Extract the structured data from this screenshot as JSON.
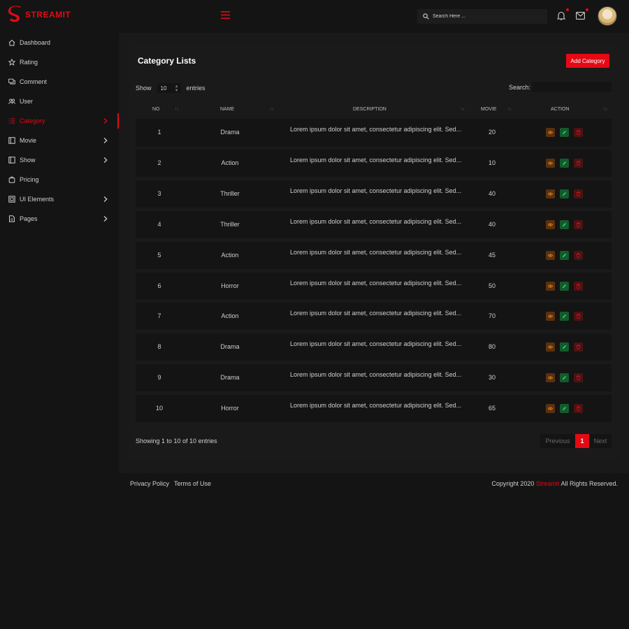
{
  "brand": {
    "name": "STREAMIT",
    "accent": "#e50914"
  },
  "sidebar": {
    "items": [
      {
        "label": "Dashboard",
        "icon": "home-icon",
        "has_submenu": false
      },
      {
        "label": "Rating",
        "icon": "star-icon",
        "has_submenu": false
      },
      {
        "label": "Comment",
        "icon": "comment-icon",
        "has_submenu": false
      },
      {
        "label": "User",
        "icon": "users-icon",
        "has_submenu": false
      },
      {
        "label": "Category",
        "icon": "list-icon",
        "has_submenu": true,
        "active": true
      },
      {
        "label": "Movie",
        "icon": "film-icon",
        "has_submenu": true
      },
      {
        "label": "Show",
        "icon": "tv-icon",
        "has_submenu": true
      },
      {
        "label": "Pricing",
        "icon": "bag-icon",
        "has_submenu": false
      },
      {
        "label": "UI Elements",
        "icon": "grid-icon",
        "has_submenu": true
      },
      {
        "label": "Pages",
        "icon": "page-icon",
        "has_submenu": true
      }
    ]
  },
  "topbar": {
    "search_placeholder": "Search Here ..."
  },
  "card": {
    "title": "Category Lists",
    "add_button": "Add Category",
    "show_label": "Show",
    "entries_value": "10",
    "entries_label": "entries",
    "search_label": "Search:"
  },
  "table": {
    "headers": {
      "no": "NO",
      "name": "NAME",
      "description": "DESCRIPTION",
      "movie": "MOVIE",
      "action": "ACTION"
    },
    "rows": [
      {
        "no": "1",
        "name": "Drama",
        "description": "Lorem ipsum dolor sit amet, consectetur adipiscing elit. Sed...",
        "movie": "20"
      },
      {
        "no": "2",
        "name": "Action",
        "description": "Lorem ipsum dolor sit amet, consectetur adipiscing elit. Sed...",
        "movie": "10"
      },
      {
        "no": "3",
        "name": "Thriller",
        "description": "Lorem ipsum dolor sit amet, consectetur adipiscing elit. Sed...",
        "movie": "40"
      },
      {
        "no": "4",
        "name": "Thriller",
        "description": "Lorem ipsum dolor sit amet, consectetur adipiscing elit. Sed...",
        "movie": "40"
      },
      {
        "no": "5",
        "name": "Action",
        "description": "Lorem ipsum dolor sit amet, consectetur adipiscing elit. Sed...",
        "movie": "45"
      },
      {
        "no": "6",
        "name": "Horror",
        "description": "Lorem ipsum dolor sit amet, consectetur adipiscing elit. Sed...",
        "movie": "50"
      },
      {
        "no": "7",
        "name": "Action",
        "description": "Lorem ipsum dolor sit amet, consectetur adipiscing elit. Sed...",
        "movie": "70"
      },
      {
        "no": "8",
        "name": "Drama",
        "description": "Lorem ipsum dolor sit amet, consectetur adipiscing elit. Sed...",
        "movie": "80"
      },
      {
        "no": "9",
        "name": "Drama",
        "description": "Lorem ipsum dolor sit amet, consectetur adipiscing elit. Sed...",
        "movie": "30"
      },
      {
        "no": "10",
        "name": "Horror",
        "description": "Lorem ipsum dolor sit amet, consectetur adipiscing elit. Sed...",
        "movie": "65"
      }
    ],
    "action_colors": {
      "view": "#e08a1e",
      "edit": "#2fd36b",
      "delete": "#e50914"
    }
  },
  "pagination": {
    "info": "Showing 1 to 10 of 10 entries",
    "previous": "Previous",
    "current": "1",
    "next": "Next"
  },
  "footer": {
    "privacy": "Privacy Policy",
    "terms": "Terms of Use",
    "copyright_pre": "Copyright 2020",
    "copyright_brand": "Streamit",
    "copyright_post": "All Rights Reserved."
  }
}
